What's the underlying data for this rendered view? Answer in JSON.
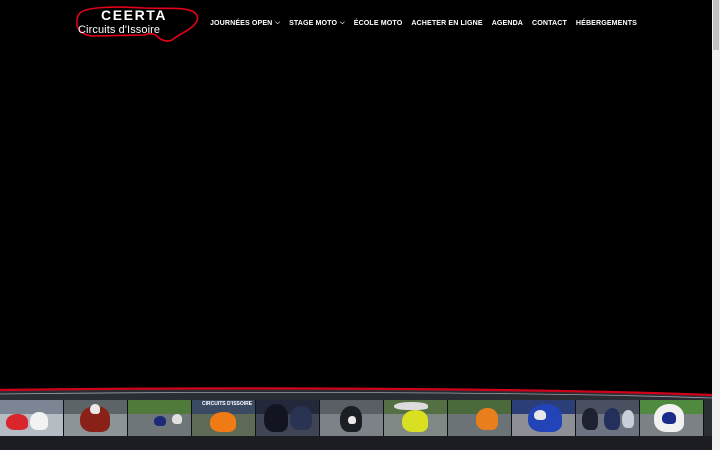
{
  "brand": {
    "name_top": "CEERTA",
    "name_bottom": "Circuits d'Issoire",
    "accent": "#e2001a"
  },
  "nav": {
    "items": [
      {
        "label": "JOURNÉES OPEN",
        "has_dropdown": true
      },
      {
        "label": "STAGE MOTO",
        "has_dropdown": true
      },
      {
        "label": "ÉCOLE MOTO",
        "has_dropdown": false
      },
      {
        "label": "ACHETER EN LIGNE",
        "has_dropdown": false
      },
      {
        "label": "AGENDA",
        "has_dropdown": false
      },
      {
        "label": "CONTACT",
        "has_dropdown": false
      },
      {
        "label": "HÉBERGEMENTS",
        "has_dropdown": false
      }
    ],
    "dropdown_icon": "chevron-down-icon"
  },
  "photo_strip": {
    "banner_text": "CIRCUITS D'ISSOIRE",
    "photo_count": 11
  }
}
